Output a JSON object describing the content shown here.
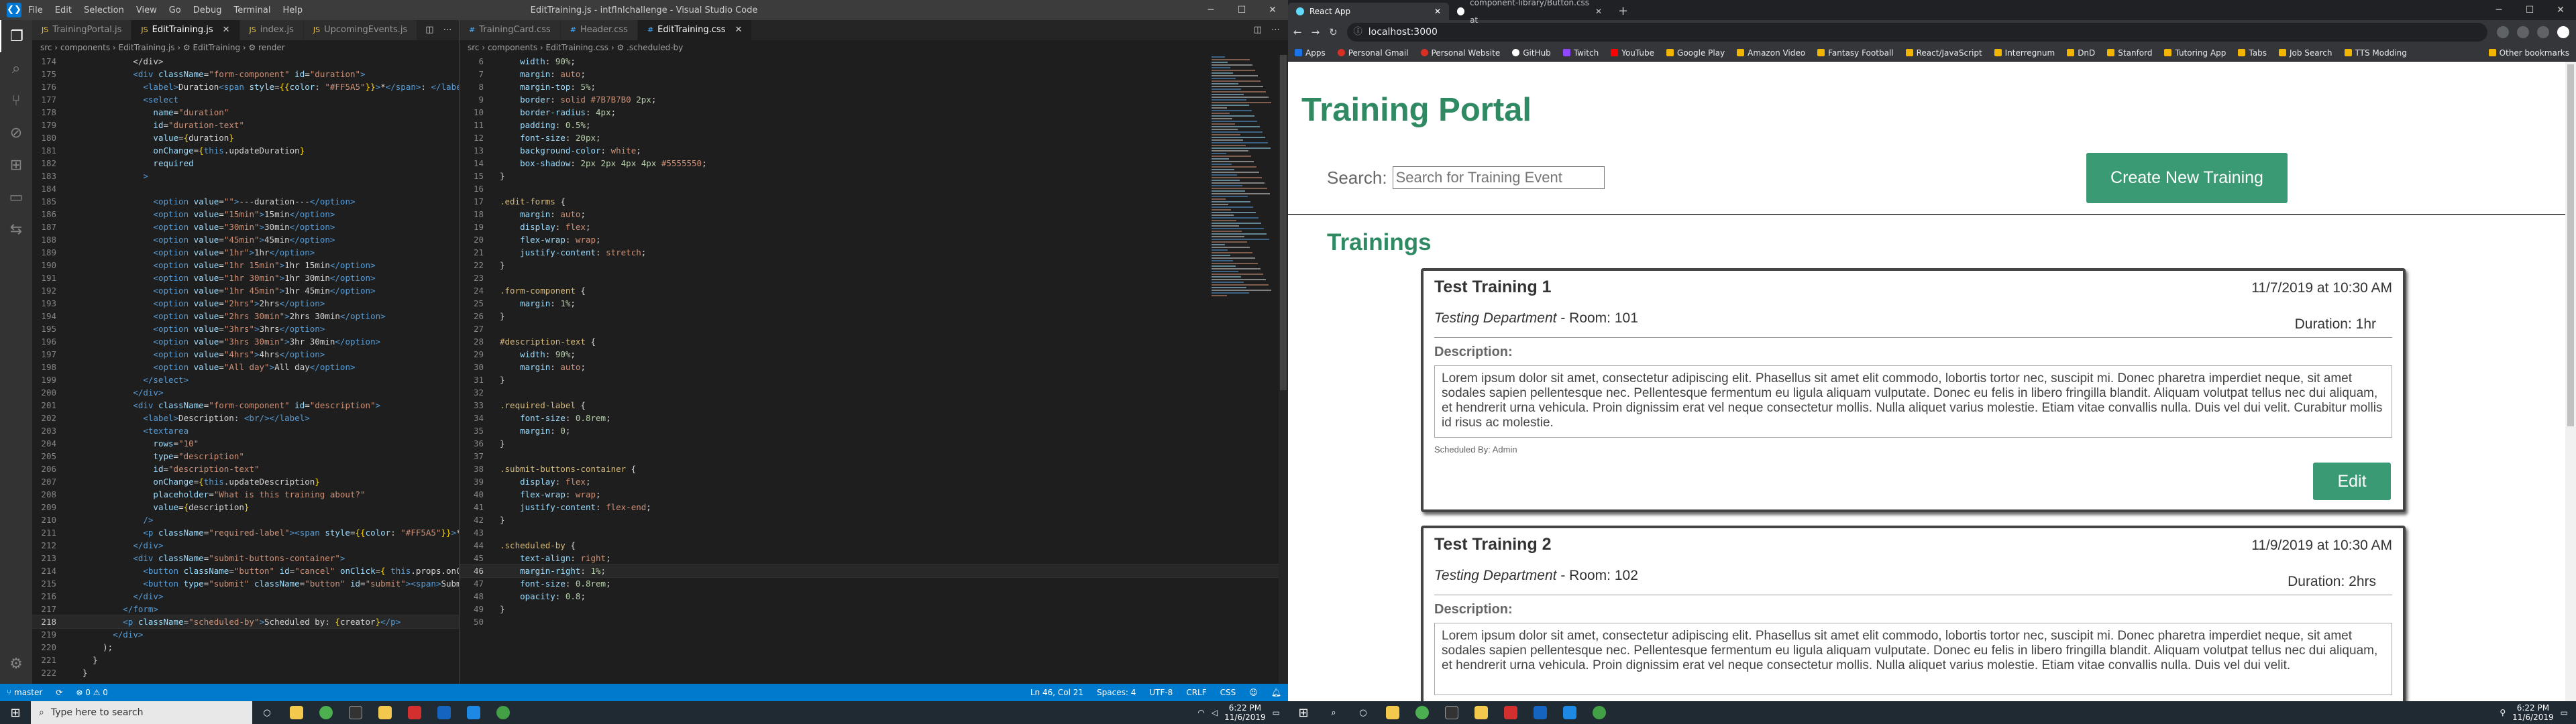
{
  "vscode": {
    "title": "EditTraining.js - intflnlchallenge - Visual Studio Code",
    "menu": [
      "File",
      "Edit",
      "Selection",
      "View",
      "Go",
      "Debug",
      "Terminal",
      "Help"
    ],
    "left_tabs": [
      "TrainingPortal.js",
      "EditTraining.js",
      "index.js",
      "UpcomingEvents.js"
    ],
    "left_breadcrumb": "src › components › EditTraining.js › ⚙ EditTraining › ⚙ render",
    "left_lines": [
      {
        "n": "174",
        "html": "            &lt;/div&gt;"
      },
      {
        "n": "175",
        "html": "            <span class='t-tag'>&lt;div</span> <span class='t-attr'>className</span>=<span class='t-str'>\"form-component\"</span> <span class='t-attr'>id</span>=<span class='t-str'>\"duration\"</span><span class='t-tag'>&gt;</span>"
      },
      {
        "n": "176",
        "html": "              <span class='t-tag'>&lt;label&gt;</span>Duration<span class='t-tag'>&lt;span</span> <span class='t-attr'>style</span>=<span class='t-br'>{{</span><span class='t-attr'>color</span>: <span class='t-str'>\"#FF5A5\"</span><span class='t-br'>}}</span><span class='t-tag'>&gt;</span>*<span class='t-tag'>&lt;/span&gt;</span>: <span class='t-tag'>&lt;/label&gt;</span>"
      },
      {
        "n": "177",
        "html": "              <span class='t-tag'>&lt;select</span>"
      },
      {
        "n": "178",
        "html": "                <span class='t-attr'>name</span>=<span class='t-str'>\"duration\"</span>"
      },
      {
        "n": "179",
        "html": "                <span class='t-attr'>id</span>=<span class='t-str'>\"duration-text\"</span>"
      },
      {
        "n": "180",
        "html": "                <span class='t-attr'>value</span>=<span class='t-br'>{</span>duration<span class='t-br'>}</span>"
      },
      {
        "n": "181",
        "html": "                <span class='t-attr'>onChange</span>=<span class='t-br'>{</span><span class='t-blu'>this</span>.updateDuration<span class='t-br'>}</span>"
      },
      {
        "n": "182",
        "html": "                <span class='t-attr'>required</span>"
      },
      {
        "n": "183",
        "html": "              <span class='t-tag'>&gt;</span>"
      },
      {
        "n": "184",
        "html": ""
      },
      {
        "n": "185",
        "html": "                <span class='t-tag'>&lt;option</span> <span class='t-attr'>value</span>=<span class='t-str'>\"\"</span><span class='t-tag'>&gt;</span>---duration---<span class='t-tag'>&lt;/option&gt;</span>"
      },
      {
        "n": "186",
        "html": "                <span class='t-tag'>&lt;option</span> <span class='t-attr'>value</span>=<span class='t-str'>\"15min\"</span><span class='t-tag'>&gt;</span>15min<span class='t-tag'>&lt;/option&gt;</span>"
      },
      {
        "n": "187",
        "html": "                <span class='t-tag'>&lt;option</span> <span class='t-attr'>value</span>=<span class='t-str'>\"30min\"</span><span class='t-tag'>&gt;</span>30min<span class='t-tag'>&lt;/option&gt;</span>"
      },
      {
        "n": "188",
        "html": "                <span class='t-tag'>&lt;option</span> <span class='t-attr'>value</span>=<span class='t-str'>\"45min\"</span><span class='t-tag'>&gt;</span>45min<span class='t-tag'>&lt;/option&gt;</span>"
      },
      {
        "n": "189",
        "html": "                <span class='t-tag'>&lt;option</span> <span class='t-attr'>value</span>=<span class='t-str'>\"1hr\"</span><span class='t-tag'>&gt;</span>1hr<span class='t-tag'>&lt;/option&gt;</span>"
      },
      {
        "n": "190",
        "html": "                <span class='t-tag'>&lt;option</span> <span class='t-attr'>value</span>=<span class='t-str'>\"1hr 15min\"</span><span class='t-tag'>&gt;</span>1hr 15min<span class='t-tag'>&lt;/option&gt;</span>"
      },
      {
        "n": "191",
        "html": "                <span class='t-tag'>&lt;option</span> <span class='t-attr'>value</span>=<span class='t-str'>\"1hr 30min\"</span><span class='t-tag'>&gt;</span>1hr 30min<span class='t-tag'>&lt;/option&gt;</span>"
      },
      {
        "n": "192",
        "html": "                <span class='t-tag'>&lt;option</span> <span class='t-attr'>value</span>=<span class='t-str'>\"1hr 45min\"</span><span class='t-tag'>&gt;</span>1hr 45min<span class='t-tag'>&lt;/option&gt;</span>"
      },
      {
        "n": "193",
        "html": "                <span class='t-tag'>&lt;option</span> <span class='t-attr'>value</span>=<span class='t-str'>\"2hrs\"</span><span class='t-tag'>&gt;</span>2hrs<span class='t-tag'>&lt;/option&gt;</span>"
      },
      {
        "n": "194",
        "html": "                <span class='t-tag'>&lt;option</span> <span class='t-attr'>value</span>=<span class='t-str'>\"2hrs 30min\"</span><span class='t-tag'>&gt;</span>2hrs 30min<span class='t-tag'>&lt;/option&gt;</span>"
      },
      {
        "n": "195",
        "html": "                <span class='t-tag'>&lt;option</span> <span class='t-attr'>value</span>=<span class='t-str'>\"3hrs\"</span><span class='t-tag'>&gt;</span>3hrs<span class='t-tag'>&lt;/option&gt;</span>"
      },
      {
        "n": "196",
        "html": "                <span class='t-tag'>&lt;option</span> <span class='t-attr'>value</span>=<span class='t-str'>\"3hrs 30min\"</span><span class='t-tag'>&gt;</span>3hr 30min<span class='t-tag'>&lt;/option&gt;</span>"
      },
      {
        "n": "197",
        "html": "                <span class='t-tag'>&lt;option</span> <span class='t-attr'>value</span>=<span class='t-str'>\"4hrs\"</span><span class='t-tag'>&gt;</span>4hrs<span class='t-tag'>&lt;/option&gt;</span>"
      },
      {
        "n": "198",
        "html": "                <span class='t-tag'>&lt;option</span> <span class='t-attr'>value</span>=<span class='t-str'>\"All day\"</span><span class='t-tag'>&gt;</span>All day<span class='t-tag'>&lt;/option&gt;</span>"
      },
      {
        "n": "199",
        "html": "              <span class='t-tag'>&lt;/select&gt;</span>"
      },
      {
        "n": "200",
        "html": "            <span class='t-tag'>&lt;/div&gt;</span>"
      },
      {
        "n": "201",
        "html": "            <span class='t-tag'>&lt;div</span> <span class='t-attr'>className</span>=<span class='t-str'>\"form-component\"</span> <span class='t-attr'>id</span>=<span class='t-str'>\"description\"</span><span class='t-tag'>&gt;</span>"
      },
      {
        "n": "202",
        "html": "              <span class='t-tag'>&lt;label&gt;</span>Description: <span class='t-tag'>&lt;br/&gt;&lt;/label&gt;</span>"
      },
      {
        "n": "203",
        "html": "              <span class='t-tag'>&lt;textarea</span>"
      },
      {
        "n": "204",
        "html": "                <span class='t-attr'>rows</span>=<span class='t-str'>\"10\"</span>"
      },
      {
        "n": "205",
        "html": "                <span class='t-attr'>type</span>=<span class='t-str'>\"description\"</span>"
      },
      {
        "n": "206",
        "html": "                <span class='t-attr'>id</span>=<span class='t-str'>\"description-text\"</span>"
      },
      {
        "n": "207",
        "html": "                <span class='t-attr'>onChange</span>=<span class='t-br'>{</span><span class='t-blu'>this</span>.updateDescription<span class='t-br'>}</span>"
      },
      {
        "n": "208",
        "html": "                <span class='t-attr'>placeholder</span>=<span class='t-str'>\"What is this training about?\"</span>"
      },
      {
        "n": "209",
        "html": "                <span class='t-attr'>value</span>=<span class='t-br'>{</span>description<span class='t-br'>}</span>"
      },
      {
        "n": "210",
        "html": "              <span class='t-tag'>/&gt;</span>"
      },
      {
        "n": "211",
        "html": "              <span class='t-tag'>&lt;p</span> <span class='t-attr'>className</span>=<span class='t-str'>\"required-label\"</span><span class='t-tag'>&gt;&lt;span</span> <span class='t-attr'>style</span>=<span class='t-br'>{{</span><span class='t-attr'>color</span>: <span class='t-str'>\"#FF5A5\"</span><span class='t-br'>}}</span><span class='t-tag'>&gt;</span>*<span class='t-tag'>&lt;/span&gt;</span> required<span class='t-tag'>&lt;/p&gt;</span>"
      },
      {
        "n": "212",
        "html": "            <span class='t-tag'>&lt;/div&gt;</span>"
      },
      {
        "n": "213",
        "html": "            <span class='t-tag'>&lt;div</span> <span class='t-attr'>className</span>=<span class='t-str'>\"submit-buttons-container\"</span><span class='t-tag'>&gt;</span>"
      },
      {
        "n": "214",
        "html": "              <span class='t-tag'>&lt;button</span> <span class='t-attr'>className</span>=<span class='t-str'>\"button\"</span> <span class='t-attr'>id</span>=<span class='t-str'>\"cancel\"</span> <span class='t-attr'>onClick</span>=<span class='t-br'>{</span> <span class='t-blu'>this</span>.props.onCancel <span class='t-br'>}</span><span class='t-tag'>&gt;&lt;span&gt;</span>Cancel<span class='t-tag'>&lt;/span&gt;&lt;/button&gt;</span>"
      },
      {
        "n": "215",
        "html": "              <span class='t-tag'>&lt;button</span> <span class='t-attr'>type</span>=<span class='t-str'>\"submit\"</span> <span class='t-attr'>className</span>=<span class='t-str'>\"button\"</span> <span class='t-attr'>id</span>=<span class='t-str'>\"submit\"</span><span class='t-tag'>&gt;&lt;span&gt;</span>Submit<span class='t-tag'>&lt;/span&gt;&lt;/button&gt;</span>"
      },
      {
        "n": "216",
        "html": "            <span class='t-tag'>&lt;/div&gt;</span>"
      },
      {
        "n": "217",
        "html": "          <span class='t-tag'>&lt;/form&gt;</span>"
      },
      {
        "n": "218",
        "html": "          <span class='t-tag'>&lt;p</span> <span class='t-attr'>className</span>=<span class='t-str'>\"scheduled-by\"</span><span class='t-tag'>&gt;</span>Scheduled by: <span class='t-br'>{</span>creator<span class='t-br'>}</span><span class='t-tag'>&lt;/p&gt;</span>"
      },
      {
        "n": "219",
        "html": "        <span class='t-tag'>&lt;/div&gt;</span>"
      },
      {
        "n": "220",
        "html": "      );"
      },
      {
        "n": "221",
        "html": "    }"
      },
      {
        "n": "222",
        "html": "  }"
      }
    ],
    "right_tabs": [
      "TrainingCard.css",
      "Header.css",
      "EditTraining.css"
    ],
    "right_breadcrumb": "src › components › EditTraining.css › ⚙ .scheduled-by",
    "right_lines": [
      {
        "n": "6",
        "html": "    <span class='t-prop'>width</span>: <span class='t-num'>90%</span>;"
      },
      {
        "n": "7",
        "html": "    <span class='t-prop'>margin</span>: <span class='t-val'>auto</span>;"
      },
      {
        "n": "8",
        "html": "    <span class='t-prop'>margin-top</span>: <span class='t-num'>5%</span>;"
      },
      {
        "n": "9",
        "html": "    <span class='t-prop'>border</span>: <span class='t-val'>solid</span> <span class='t-val'>#7B7B7B0</span> <span class='t-num'>2px</span>;"
      },
      {
        "n": "10",
        "html": "    <span class='t-prop'>border-radius</span>: <span class='t-num'>4px</span>;"
      },
      {
        "n": "11",
        "html": "    <span class='t-prop'>padding</span>: <span class='t-num'>0.5%</span>;"
      },
      {
        "n": "12",
        "html": "    <span class='t-prop'>font-size</span>: <span class='t-num'>20px</span>;"
      },
      {
        "n": "13",
        "html": "    <span class='t-prop'>background-color</span>: <span class='t-val'>white</span>;"
      },
      {
        "n": "14",
        "html": "    <span class='t-prop'>box-shadow</span>: <span class='t-num'>2px 2px 4px 4px</span> <span class='t-val'>#5555550</span>;"
      },
      {
        "n": "15",
        "html": "}"
      },
      {
        "n": "16",
        "html": ""
      },
      {
        "n": "17",
        "html": "<span class='t-sel'>.edit-forms</span> {"
      },
      {
        "n": "18",
        "html": "    <span class='t-prop'>margin</span>: <span class='t-val'>auto</span>;"
      },
      {
        "n": "19",
        "html": "    <span class='t-prop'>display</span>: <span class='t-val'>flex</span>;"
      },
      {
        "n": "20",
        "html": "    <span class='t-prop'>flex-wrap</span>: <span class='t-val'>wrap</span>;"
      },
      {
        "n": "21",
        "html": "    <span class='t-prop'>justify-content</span>: <span class='t-val'>stretch</span>;"
      },
      {
        "n": "22",
        "html": "}"
      },
      {
        "n": "23",
        "html": ""
      },
      {
        "n": "24",
        "html": "<span class='t-sel'>.form-component</span> {"
      },
      {
        "n": "25",
        "html": "    <span class='t-prop'>margin</span>: <span class='t-num'>1%</span>;"
      },
      {
        "n": "26",
        "html": "}"
      },
      {
        "n": "27",
        "html": ""
      },
      {
        "n": "28",
        "html": "<span class='t-sel'>#description-text</span> {"
      },
      {
        "n": "29",
        "html": "    <span class='t-prop'>width</span>: <span class='t-num'>90%</span>;"
      },
      {
        "n": "30",
        "html": "    <span class='t-prop'>margin</span>: <span class='t-val'>auto</span>;"
      },
      {
        "n": "31",
        "html": "}"
      },
      {
        "n": "32",
        "html": ""
      },
      {
        "n": "33",
        "html": "<span class='t-sel'>.required-label</span> {"
      },
      {
        "n": "34",
        "html": "    <span class='t-prop'>font-size</span>: <span class='t-num'>0.8rem</span>;"
      },
      {
        "n": "35",
        "html": "    <span class='t-prop'>margin</span>: <span class='t-num'>0</span>;"
      },
      {
        "n": "36",
        "html": "}"
      },
      {
        "n": "37",
        "html": ""
      },
      {
        "n": "38",
        "html": "<span class='t-sel'>.submit-buttons-container</span> {"
      },
      {
        "n": "39",
        "html": "    <span class='t-prop'>display</span>: <span class='t-val'>flex</span>;"
      },
      {
        "n": "40",
        "html": "    <span class='t-prop'>flex-wrap</span>: <span class='t-val'>wrap</span>;"
      },
      {
        "n": "41",
        "html": "    <span class='t-prop'>justify-content</span>: <span class='t-val'>flex-end</span>;"
      },
      {
        "n": "42",
        "html": "}"
      },
      {
        "n": "43",
        "html": ""
      },
      {
        "n": "44",
        "html": "<span class='t-sel'>.scheduled-by</span> {"
      },
      {
        "n": "45",
        "html": "    <span class='t-prop'>text-align</span>: <span class='t-val'>right</span>;"
      },
      {
        "n": "46",
        "html": "    <span class='t-prop'>margin-right</span>: <span class='t-num'>1%</span>;"
      },
      {
        "n": "47",
        "html": "    <span class='t-prop'>font-size</span>: <span class='t-num'>0.8rem</span>;"
      },
      {
        "n": "48",
        "html": "    <span class='t-prop'>opacity</span>: <span class='t-num'>0.8</span>;"
      },
      {
        "n": "49",
        "html": "}"
      },
      {
        "n": "50",
        "html": ""
      }
    ],
    "status": {
      "branch": "master",
      "problems": "⊗ 0 ⚠ 0",
      "position": "Ln 46, Col 21",
      "spaces": "Spaces: 4",
      "encoding": "UTF-8",
      "eol": "CRLF",
      "lang": "CSS"
    }
  },
  "chrome": {
    "tabs": [
      "React App",
      "component-library/Button.css at"
    ],
    "url": "localhost:3000",
    "bookmarks": [
      "Apps",
      "Personal Gmail",
      "Personal Website",
      "GitHub",
      "Twitch",
      "YouTube",
      "Google Play",
      "Amazon Video",
      "Fantasy Football",
      "React/JavaScript",
      "Interregnum",
      "DnD",
      "Stanford",
      "Tutoring App",
      "Tabs",
      "Job Search",
      "TTS Modding"
    ],
    "other_bookmarks": "Other bookmarks"
  },
  "portal": {
    "title": "Training Portal",
    "search_label": "Search:",
    "search_placeholder": "Search for Training Event",
    "create_button": "Create New Training",
    "section_title": "Trainings",
    "description_label": "Description:",
    "edit_label": "Edit",
    "cards": [
      {
        "name": "Test Training 1",
        "date": "11/7/2019 at 10:30 AM",
        "department": "Testing Department",
        "room": " - Room: 101",
        "duration": "Duration: 1hr",
        "description": "Lorem ipsum dolor sit amet, consectetur adipiscing elit. Phasellus sit amet elit commodo, lobortis tortor nec, suscipit mi. Donec pharetra imperdiet neque, sit amet sodales sapien pellentesque nec. Pellentesque fermentum eu ligula aliquam vulputate. Donec eu felis in libero fringilla blandit. Aliquam volutpat tellus nec dui aliquam, et hendrerit urna vehicula. Proin dignissim erat vel neque consectetur mollis. Nulla aliquet varius molestie. Etiam vitae convallis nulla. Duis vel dui velit. Curabitur mollis id risus ac molestie.",
        "scheduled": "Scheduled By: Admin"
      },
      {
        "name": "Test Training 2",
        "date": "11/9/2019 at 10:30 AM",
        "department": "Testing Department",
        "room": " - Room: 102",
        "duration": "Duration: 2hrs",
        "description": "Lorem ipsum dolor sit amet, consectetur adipiscing elit. Phasellus sit amet elit commodo, lobortis tortor nec, suscipit mi. Donec pharetra imperdiet neque, sit amet sodales sapien pellentesque nec. Pellentesque fermentum eu ligula aliquam vulputate. Donec eu felis in libero fringilla blandit. Aliquam volutpat tellus nec dui aliquam, et hendrerit urna vehicula. Proin dignissim erat vel neque consectetur mollis. Nulla aliquet varius molestie. Etiam vitae convallis nulla. Duis vel dui velit."
      }
    ]
  },
  "taskbar": {
    "search_placeholder": "Type here to search",
    "time": "6:22 PM",
    "date": "11/6/2019"
  },
  "colors": {
    "brand_green": "#2f8a63",
    "button_green": "#3a9a74",
    "vscode_status": "#007acc"
  }
}
